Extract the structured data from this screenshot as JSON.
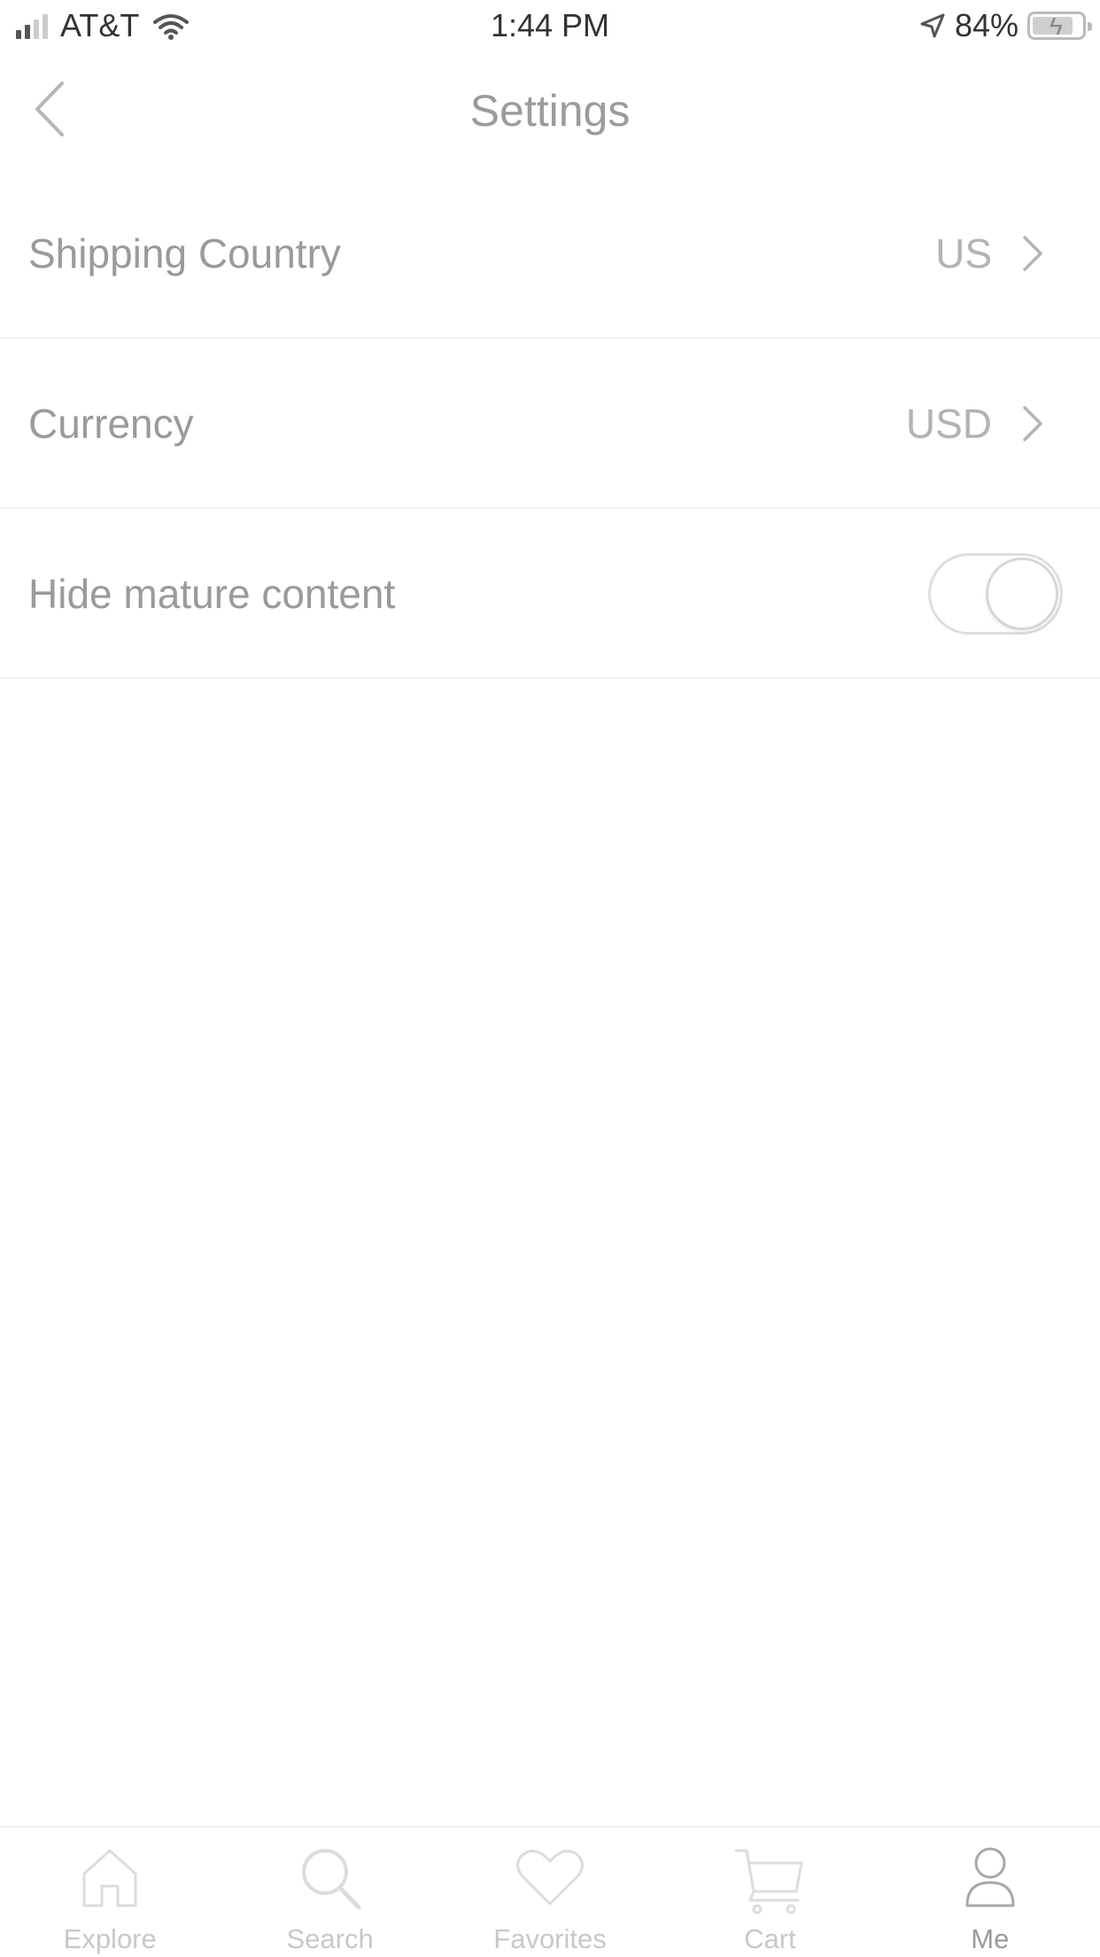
{
  "status_bar": {
    "carrier": "AT&T",
    "time": "1:44 PM",
    "battery": "84%",
    "battery_level": 0.84,
    "signal_bars_filled": 2,
    "signal_bars_total": 4
  },
  "nav": {
    "title": "Settings",
    "back_icon": "chevron-left-icon"
  },
  "settings": {
    "rows": [
      {
        "label": "Shipping Country",
        "value": "US",
        "icon": "chevron-right-icon"
      },
      {
        "label": "Currency",
        "value": "USD",
        "icon": "chevron-right-icon"
      },
      {
        "label": "Hide mature content",
        "toggle_on": false
      }
    ]
  },
  "tabs": [
    {
      "label": "Explore",
      "icon": "home-icon",
      "active": false
    },
    {
      "label": "Search",
      "icon": "search-icon",
      "active": false
    },
    {
      "label": "Favorites",
      "icon": "heart-icon",
      "active": false
    },
    {
      "label": "Cart",
      "icon": "cart-icon",
      "active": false
    },
    {
      "label": "Me",
      "icon": "person-icon",
      "active": true
    }
  ],
  "colors": {
    "text_primary": "#9a9a9a",
    "text_secondary": "#b3b3b3",
    "tab_inactive": "#c8c8c8",
    "divider": "#f3f3f3"
  }
}
